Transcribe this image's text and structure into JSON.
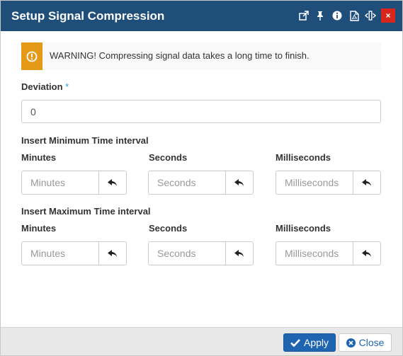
{
  "window": {
    "title": "Setup Signal Compression"
  },
  "toolbar_icons": [
    {
      "name": "popout-icon"
    },
    {
      "name": "pin-icon"
    },
    {
      "name": "info-icon"
    },
    {
      "name": "pdf-icon"
    },
    {
      "name": "resize-icon"
    },
    {
      "name": "close-icon",
      "label": "×"
    }
  ],
  "warning": {
    "text": "WARNING! Compressing signal data takes a long time to finish.",
    "icon": "exclamation-circle-icon",
    "color": "#e49a17"
  },
  "deviation": {
    "label": "Deviation",
    "required_mark": "*",
    "value": "0"
  },
  "min_interval": {
    "heading": "Insert Minimum Time interval",
    "minutes_label": "Minutes",
    "minutes_placeholder": "Minutes",
    "seconds_label": "Seconds",
    "seconds_placeholder": "Seconds",
    "ms_label": "Milliseconds",
    "ms_placeholder": "Milliseconds"
  },
  "max_interval": {
    "heading": "Insert Maximum Time interval",
    "minutes_label": "Minutes",
    "minutes_placeholder": "Minutes",
    "seconds_label": "Seconds",
    "seconds_placeholder": "Seconds",
    "ms_label": "Milliseconds",
    "ms_placeholder": "Milliseconds"
  },
  "footer": {
    "apply_label": "Apply",
    "close_label": "Close",
    "accent": "#1f64b0"
  }
}
